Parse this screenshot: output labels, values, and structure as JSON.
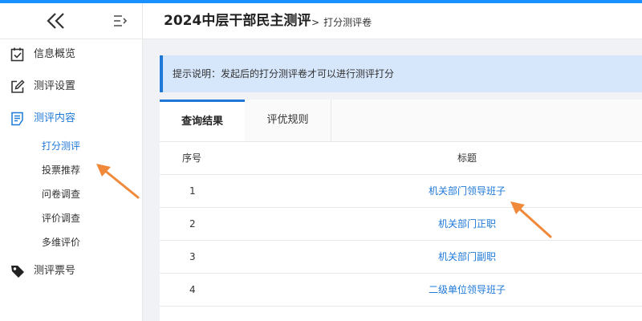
{
  "colors": {
    "accent": "#1e78d7",
    "arrow": "#f0893a",
    "notice_bg": "#d6e6fb"
  },
  "sidebar": {
    "collapse_icon": "double-chevron-left-icon",
    "toggle_icon": "menu-fold-icon",
    "items": [
      {
        "label": "信息概览",
        "icon": "checkbox-icon"
      },
      {
        "label": "测评设置",
        "icon": "edit-icon"
      },
      {
        "label": "测评内容",
        "icon": "list-icon"
      },
      {
        "label": "测评票号",
        "icon": "tag-icon"
      }
    ],
    "sub_items": [
      {
        "label": "打分测评"
      },
      {
        "label": "投票推荐"
      },
      {
        "label": "问卷调查"
      },
      {
        "label": "评价调查"
      },
      {
        "label": "多维评价"
      }
    ]
  },
  "header": {
    "title": "2024中层干部民主测评",
    "separator": ">",
    "breadcrumb": "打分测评卷"
  },
  "notice": {
    "text": "提示说明：发起后的打分测评卷才可以进行测评打分"
  },
  "tabs": [
    {
      "label": "查询结果"
    },
    {
      "label": "评优规则"
    }
  ],
  "table": {
    "columns": [
      "序号",
      "标题"
    ],
    "rows": [
      {
        "index": "1",
        "title": "机关部门领导班子"
      },
      {
        "index": "2",
        "title": "机关部门正职"
      },
      {
        "index": "3",
        "title": "机关部门副职"
      },
      {
        "index": "4",
        "title": "二级单位领导班子"
      }
    ]
  }
}
